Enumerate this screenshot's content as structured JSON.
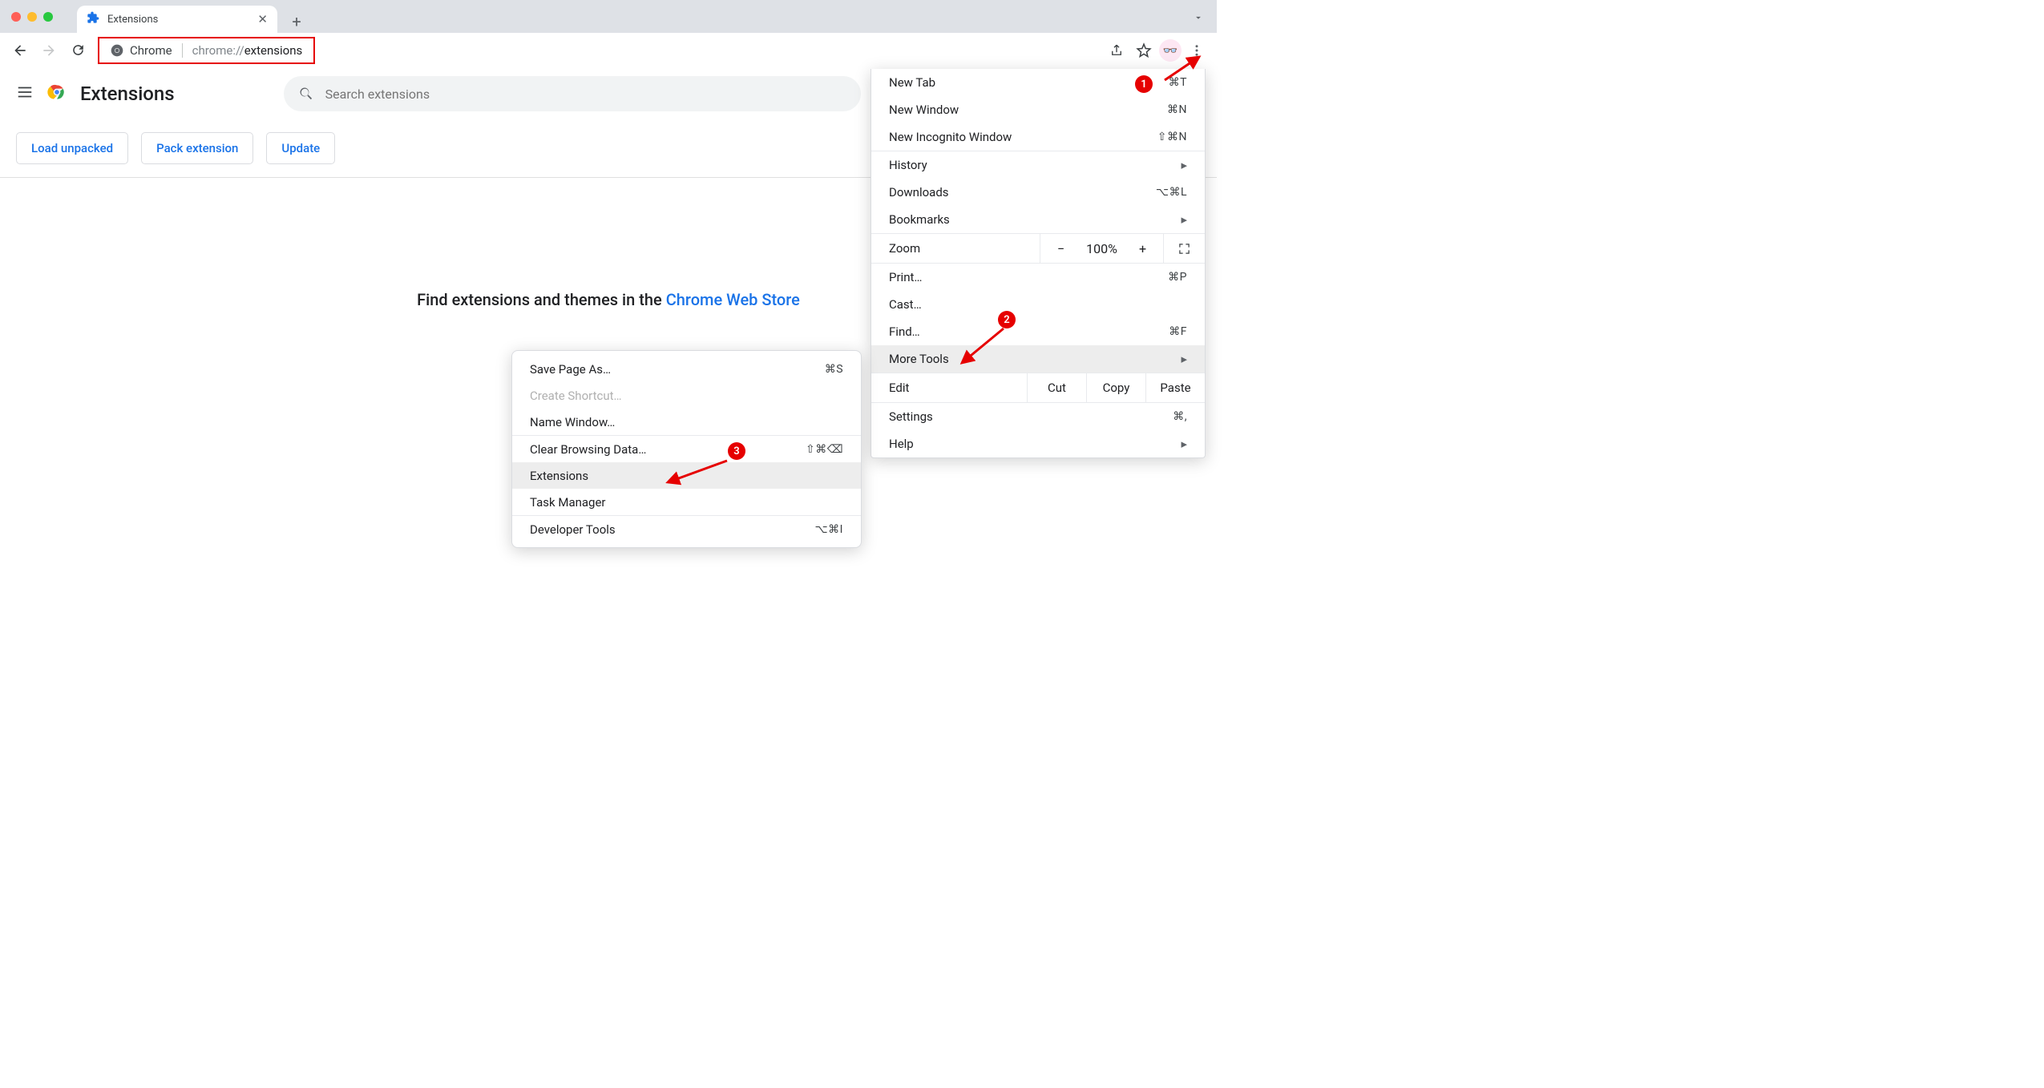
{
  "window": {
    "tab_title": "Extensions"
  },
  "toolbar": {
    "chip_label": "Chrome",
    "url_prefix": "chrome://",
    "url_bold": "extensions"
  },
  "ext_page": {
    "title": "Extensions",
    "search_placeholder": "Search extensions",
    "buttons": {
      "load": "Load unpacked",
      "pack": "Pack extension",
      "update": "Update"
    },
    "message_prefix": "Find extensions and themes in the ",
    "message_link": "Chrome Web Store"
  },
  "main_menu": {
    "new_tab": "New Tab",
    "new_tab_k": "⌘T",
    "new_window": "New Window",
    "new_window_k": "⌘N",
    "incognito": "New Incognito Window",
    "incognito_k": "⇧⌘N",
    "history": "History",
    "downloads": "Downloads",
    "downloads_k": "⌥⌘L",
    "bookmarks": "Bookmarks",
    "zoom": "Zoom",
    "zoom_minus": "−",
    "zoom_val": "100%",
    "zoom_plus": "+",
    "print": "Print…",
    "print_k": "⌘P",
    "cast": "Cast…",
    "find": "Find…",
    "find_k": "⌘F",
    "more_tools": "More Tools",
    "edit": "Edit",
    "cut": "Cut",
    "copy": "Copy",
    "paste": "Paste",
    "settings": "Settings",
    "settings_k": "⌘,",
    "help": "Help"
  },
  "sub_menu": {
    "save_as": "Save Page As…",
    "save_as_k": "⌘S",
    "create_shortcut": "Create Shortcut…",
    "name_window": "Name Window…",
    "clear_data": "Clear Browsing Data…",
    "clear_data_k": "⇧⌘⌫",
    "extensions": "Extensions",
    "task_manager": "Task Manager",
    "dev_tools": "Developer Tools",
    "dev_tools_k": "⌥⌘I"
  },
  "annotations": {
    "b1": "1",
    "b2": "2",
    "b3": "3"
  }
}
